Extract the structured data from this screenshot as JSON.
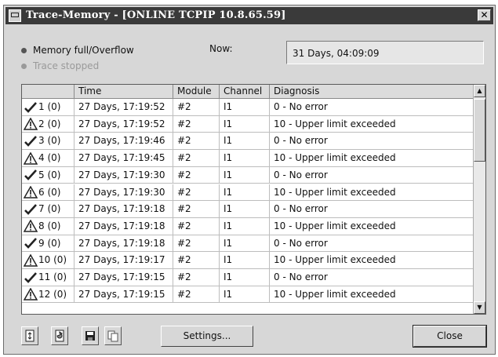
{
  "window": {
    "title": "Trace-Memory - [ONLINE TCPIP 10.8.65.59]",
    "close_glyph": "✕"
  },
  "status": {
    "memory_full_label": "Memory full/Overflow",
    "trace_stopped_label": "Trace stopped",
    "now_label": "Now:",
    "now_value": "31 Days, 04:09:09"
  },
  "table": {
    "columns": [
      "",
      "Time",
      "Module",
      "Channel",
      "Diagnosis"
    ],
    "rows": [
      {
        "icon": "check-icon",
        "id": "1 (0)",
        "time": "27 Days, 17:19:52",
        "module": "#2",
        "channel": "I1",
        "diagnosis": "0 - No error"
      },
      {
        "icon": "warning-icon",
        "id": "2 (0)",
        "time": "27 Days, 17:19:52",
        "module": "#2",
        "channel": "I1",
        "diagnosis": "10 - Upper limit exceeded"
      },
      {
        "icon": "check-icon",
        "id": "3 (0)",
        "time": "27 Days, 17:19:46",
        "module": "#2",
        "channel": "I1",
        "diagnosis": "0 - No error"
      },
      {
        "icon": "warning-icon",
        "id": "4 (0)",
        "time": "27 Days, 17:19:45",
        "module": "#2",
        "channel": "I1",
        "diagnosis": "10 - Upper limit exceeded"
      },
      {
        "icon": "check-icon",
        "id": "5 (0)",
        "time": "27 Days, 17:19:30",
        "module": "#2",
        "channel": "I1",
        "diagnosis": "0 - No error"
      },
      {
        "icon": "warning-icon",
        "id": "6 (0)",
        "time": "27 Days, 17:19:30",
        "module": "#2",
        "channel": "I1",
        "diagnosis": "10 - Upper limit exceeded"
      },
      {
        "icon": "check-icon",
        "id": "7 (0)",
        "time": "27 Days, 17:19:18",
        "module": "#2",
        "channel": "I1",
        "diagnosis": "0 - No error"
      },
      {
        "icon": "warning-icon",
        "id": "8 (0)",
        "time": "27 Days, 17:19:18",
        "module": "#2",
        "channel": "I1",
        "diagnosis": "10 - Upper limit exceeded"
      },
      {
        "icon": "check-icon",
        "id": "9 (0)",
        "time": "27 Days, 17:19:18",
        "module": "#2",
        "channel": "I1",
        "diagnosis": "0 - No error"
      },
      {
        "icon": "warning-icon",
        "id": "10 (0)",
        "time": "27 Days, 17:19:17",
        "module": "#2",
        "channel": "I1",
        "diagnosis": "10 - Upper limit exceeded"
      },
      {
        "icon": "check-icon",
        "id": "11 (0)",
        "time": "27 Days, 17:19:15",
        "module": "#2",
        "channel": "I1",
        "diagnosis": "0 - No error"
      },
      {
        "icon": "warning-icon",
        "id": "12 (0)",
        "time": "27 Days, 17:19:15",
        "module": "#2",
        "channel": "I1",
        "diagnosis": "10 - Upper limit exceeded"
      }
    ]
  },
  "toolbar": {
    "icons": [
      "document-refresh-icon",
      "document-reload-icon",
      "save-icon",
      "copy-icon"
    ]
  },
  "buttons": {
    "settings": "Settings...",
    "close": "Close"
  }
}
